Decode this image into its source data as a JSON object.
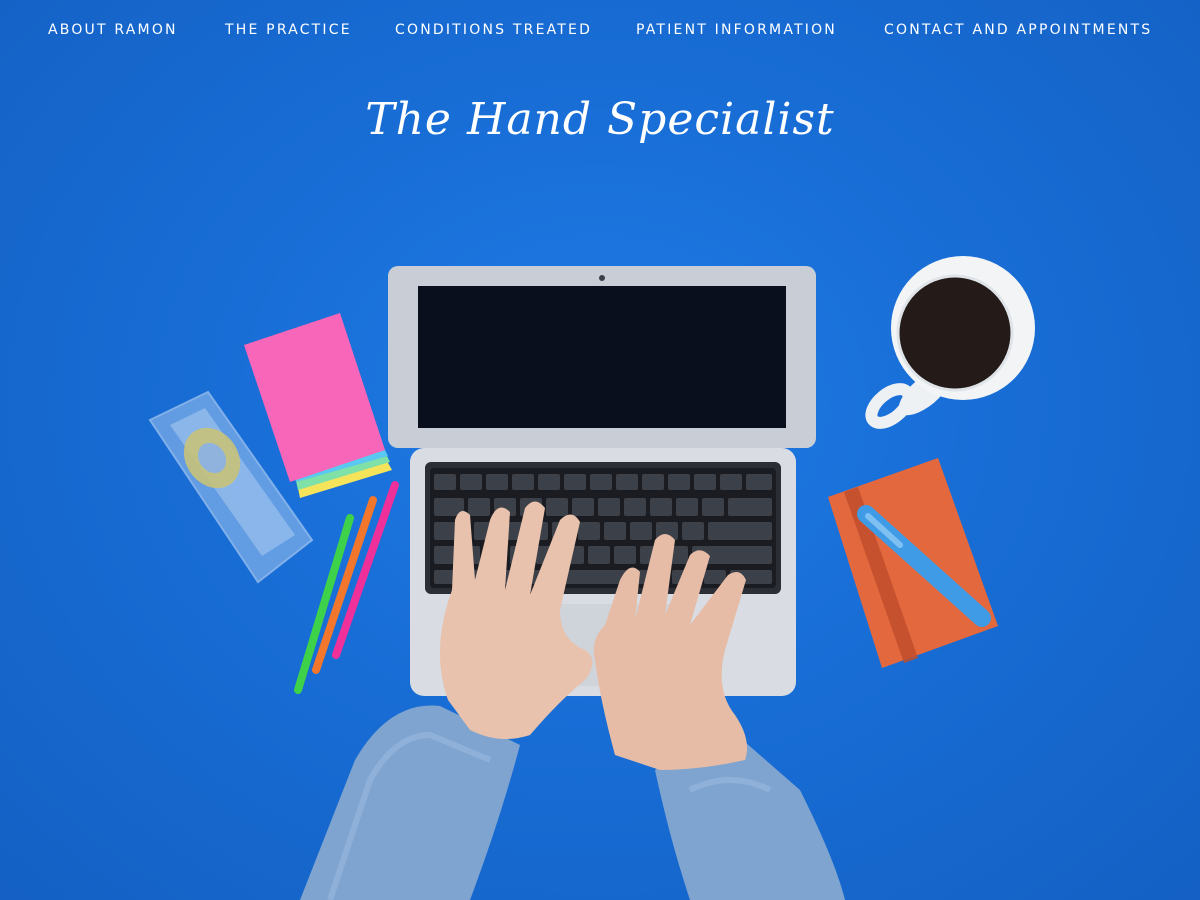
{
  "nav": {
    "items": [
      {
        "label": "ABOUT RAMON"
      },
      {
        "label": "THE PRACTICE"
      },
      {
        "label": "CONDITIONS TREATED"
      },
      {
        "label": "PATIENT INFORMATION"
      },
      {
        "label": "CONTACT AND APPOINTMENTS"
      }
    ]
  },
  "logo": {
    "text": "The Hand Specialist"
  },
  "colors": {
    "background": "#1a6fd8",
    "nav_text": "#ffffff"
  },
  "hero_image": {
    "icons": [
      "laptop-icon",
      "hands-icon",
      "coffee-cup-icon",
      "notebook-icon",
      "highlighter-icon",
      "sticky-notes-icon",
      "tape-dispenser-icon",
      "pens-icon"
    ]
  }
}
